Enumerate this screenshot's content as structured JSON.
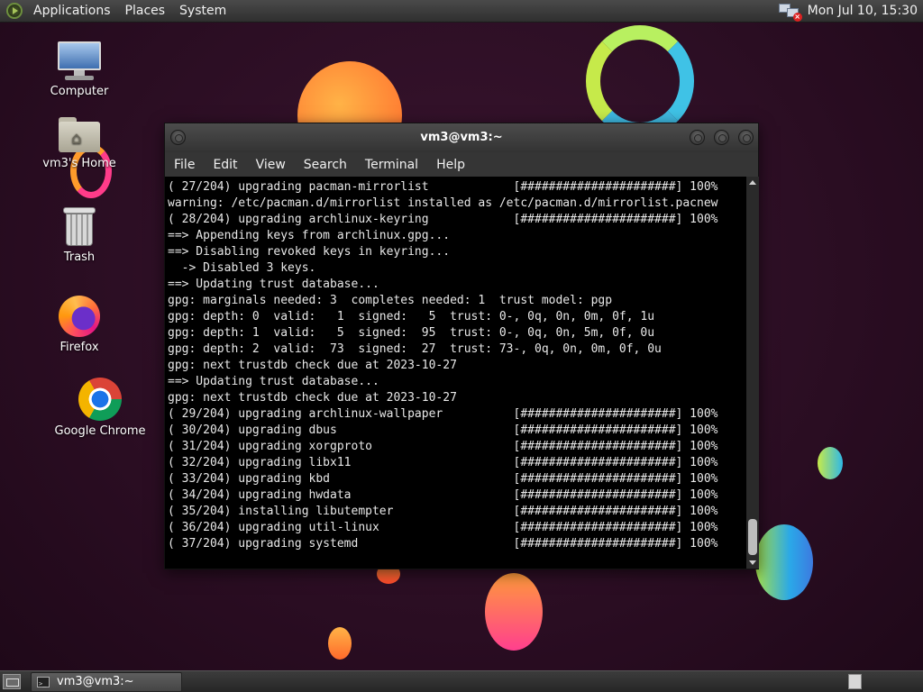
{
  "top_panel": {
    "menus": [
      "Applications",
      "Places",
      "System"
    ],
    "clock": "Mon Jul 10, 15:30"
  },
  "desktop": {
    "icons": [
      {
        "label": "Computer"
      },
      {
        "label": "vm3's Home"
      },
      {
        "label": "Trash"
      },
      {
        "label": "Firefox"
      },
      {
        "label": "Google Chrome"
      }
    ]
  },
  "window": {
    "title": "vm3@vm3:~",
    "menu": [
      "File",
      "Edit",
      "View",
      "Search",
      "Terminal",
      "Help"
    ]
  },
  "terminal": {
    "lines": [
      "( 27/204) upgrading pacman-mirrorlist            [######################] 100%",
      "warning: /etc/pacman.d/mirrorlist installed as /etc/pacman.d/mirrorlist.pacnew",
      "( 28/204) upgrading archlinux-keyring            [######################] 100%",
      "==> Appending keys from archlinux.gpg...",
      "==> Disabling revoked keys in keyring...",
      "  -> Disabled 3 keys.",
      "==> Updating trust database...",
      "gpg: marginals needed: 3  completes needed: 1  trust model: pgp",
      "gpg: depth: 0  valid:   1  signed:   5  trust: 0-, 0q, 0n, 0m, 0f, 1u",
      "gpg: depth: 1  valid:   5  signed:  95  trust: 0-, 0q, 0n, 5m, 0f, 0u",
      "gpg: depth: 2  valid:  73  signed:  27  trust: 73-, 0q, 0n, 0m, 0f, 0u",
      "gpg: next trustdb check due at 2023-10-27",
      "==> Updating trust database...",
      "gpg: next trustdb check due at 2023-10-27",
      "( 29/204) upgrading archlinux-wallpaper          [######################] 100%",
      "( 30/204) upgrading dbus                         [######################] 100%",
      "( 31/204) upgrading xorgproto                    [######################] 100%",
      "( 32/204) upgrading libx11                       [######################] 100%",
      "( 33/204) upgrading kbd                          [######################] 100%",
      "( 34/204) upgrading hwdata                       [######################] 100%",
      "( 35/204) installing libutempter                 [######################] 100%",
      "( 36/204) upgrading util-linux                   [######################] 100%",
      "( 37/204) upgrading systemd                      [######################] 100%"
    ]
  },
  "taskbar": {
    "task_label": "vm3@vm3:~"
  }
}
